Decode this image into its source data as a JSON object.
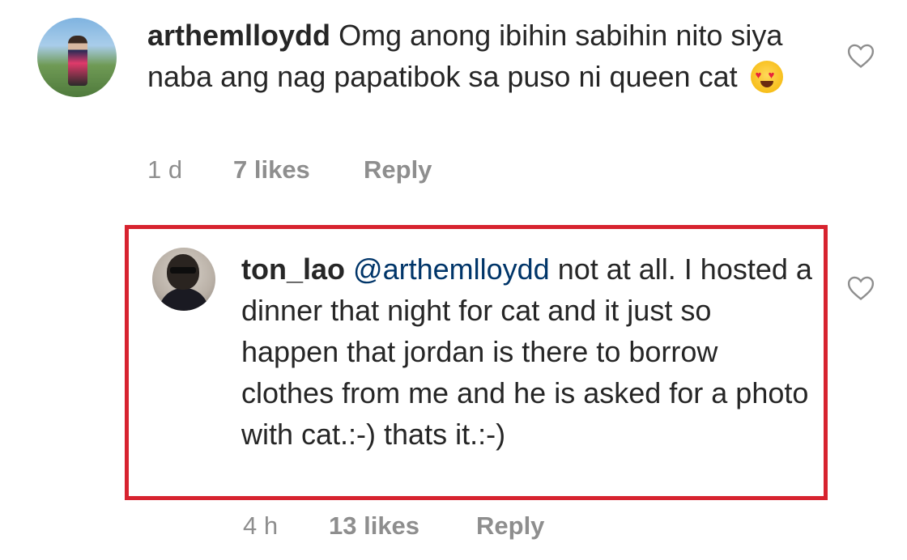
{
  "comments": [
    {
      "username": "arthemlloydd",
      "text": "Omg anong ibihin sabihin nito siya naba ang nag papatibok sa puso ni queen cat",
      "emoji": "heart-eyes-emoji",
      "time": "1 d",
      "likes": "7 likes",
      "reply_label": "Reply"
    },
    {
      "username": "ton_lao",
      "mention": "@arthemlloydd",
      "text": "not at all. I hosted a dinner that night for cat and it just so happen that jordan is there to borrow clothes from me and he is asked for a photo with cat.:-) thats it.:-)",
      "time": "4 h",
      "likes": "13 likes",
      "reply_label": "Reply"
    }
  ],
  "icons": {
    "like": "heart-outline-icon"
  },
  "colors": {
    "highlight_border": "#d7232f",
    "mention": "#003569",
    "meta_text": "#8e8e8e"
  }
}
